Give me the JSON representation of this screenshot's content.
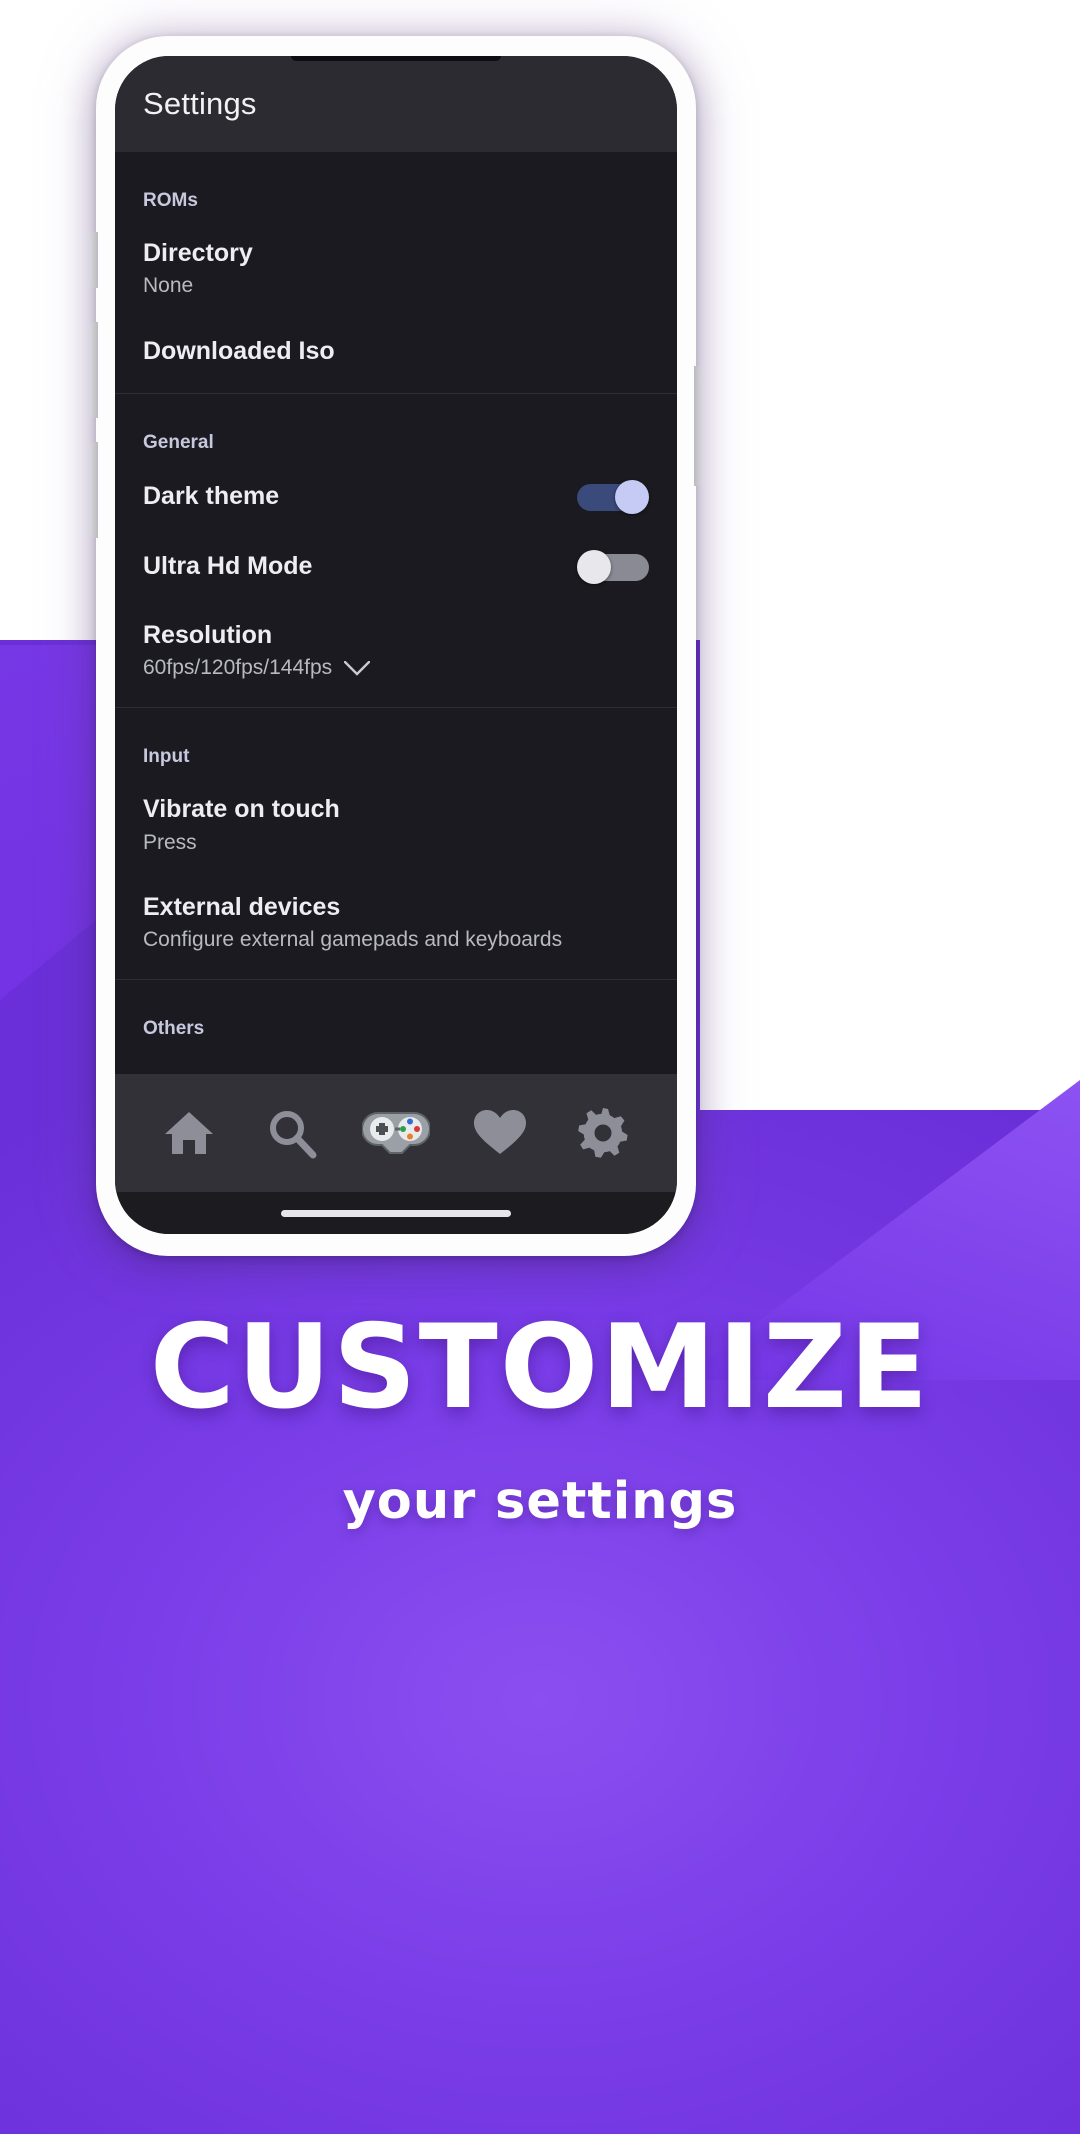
{
  "background": {
    "purple": "#7433e4",
    "white": "#ffffff"
  },
  "phone": {
    "frame_color": "#fdfdfd",
    "screen_bg": "#1a1a20"
  },
  "app": {
    "header": {
      "title": "Settings",
      "bg": "#2b2b31"
    },
    "sections": [
      {
        "id": "roms",
        "title": "ROMs",
        "rows": [
          {
            "id": "directory",
            "title": "Directory",
            "subtitle": "None",
            "control": "none"
          },
          {
            "id": "downloaded-iso",
            "title": "Downloaded Iso",
            "subtitle": "",
            "control": "none"
          }
        ]
      },
      {
        "id": "general",
        "title": "General",
        "rows": [
          {
            "id": "dark-theme",
            "title": "Dark theme",
            "subtitle": "",
            "control": "toggle",
            "value": "on"
          },
          {
            "id": "ultra-hd-mode",
            "title": "Ultra Hd Mode",
            "subtitle": "",
            "control": "toggle",
            "value": "off"
          },
          {
            "id": "resolution",
            "title": "Resolution",
            "subtitle": "60fps/120fps/144fps",
            "control": "chevron"
          }
        ]
      },
      {
        "id": "input",
        "title": "Input",
        "rows": [
          {
            "id": "vibrate-on-touch",
            "title": "Vibrate on touch",
            "subtitle": "Press",
            "control": "none"
          },
          {
            "id": "external-devices",
            "title": "External devices",
            "subtitle": "Configure external gamepads and keyboards",
            "control": "none"
          }
        ]
      },
      {
        "id": "others",
        "title": "Others",
        "rows": []
      }
    ],
    "toggle_colors": {
      "on_track": "#3a4a7a",
      "on_knob": "#c5cbf5",
      "off_track": "#8a8a95",
      "off_knob": "#e8e8ec"
    },
    "bottom_nav": {
      "bg": "#313137",
      "items": [
        {
          "id": "home",
          "icon": "home-icon",
          "active": false
        },
        {
          "id": "search",
          "icon": "search-icon",
          "active": false
        },
        {
          "id": "games",
          "icon": "gamepad-icon",
          "active": true
        },
        {
          "id": "favorites",
          "icon": "heart-icon",
          "active": false
        },
        {
          "id": "settings",
          "icon": "gear-icon",
          "active": false
        }
      ]
    }
  },
  "promo": {
    "headline": "Customize",
    "subline": "your settings"
  }
}
